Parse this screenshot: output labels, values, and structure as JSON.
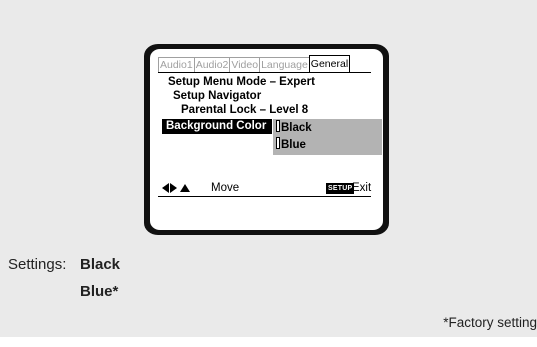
{
  "screen": {
    "tabs": [
      {
        "label": "Audio1",
        "active": false
      },
      {
        "label": "Audio2",
        "active": false
      },
      {
        "label": "Video",
        "active": false
      },
      {
        "label": "Language",
        "active": false
      },
      {
        "label": "General",
        "active": true
      }
    ],
    "menu": {
      "line1": "Setup Menu Mode – Expert",
      "line2": "Setup Navigator",
      "line3": "Parental Lock – Level 8",
      "selected_item": "Background Color"
    },
    "options": [
      "Black",
      "Blue"
    ],
    "footer": {
      "move_label": "Move",
      "setup_badge": "SETUP",
      "exit_label": "Exit"
    }
  },
  "settings": {
    "label": "Settings:",
    "values": [
      "Black",
      "Blue*"
    ],
    "footnote": "*Factory setting"
  },
  "colors": {
    "background": "#eaeaea",
    "bezel": "#111111",
    "highlight": "#000000",
    "option_bg": "#b3b3b3",
    "inactive_tab": "#a0a0a0"
  },
  "icons": [
    "arrow-left-icon",
    "arrow-right-icon",
    "arrow-up-icon"
  ]
}
